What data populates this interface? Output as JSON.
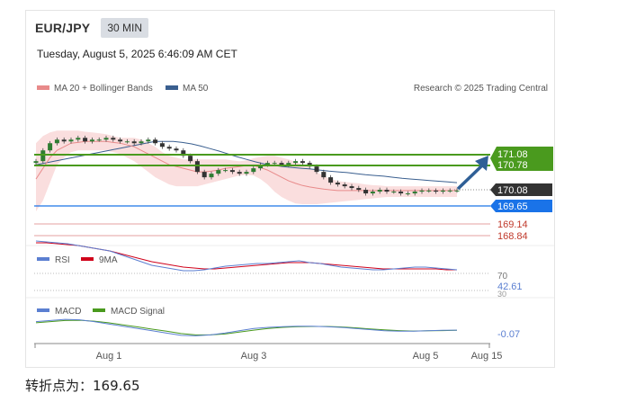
{
  "header": {
    "pair": "EUR/JPY",
    "interval": "30 MIN",
    "datetime": "Tuesday, August 5, 2025 6:46:09 AM CET"
  },
  "legend": {
    "ma20": "MA 20 + Bollinger Bands",
    "ma50": "MA 50",
    "credit": "Research © 2025 Trading Central",
    "ma20_color": "#e88a8a",
    "ma50_color": "#3a5f8f"
  },
  "levels": {
    "resistance1": "171.08",
    "resistance2": "170.78",
    "last": "170.08",
    "pivot": "169.65",
    "support1": "169.14",
    "support2": "168.84",
    "resistance_color": "#4a9a1e",
    "pivot_color": "#1a73e8",
    "support_color": "#c0392b",
    "last_color": "#333333"
  },
  "rsi": {
    "label": "RSI",
    "ma_label": "9MA",
    "upper": "70",
    "value": "42.61",
    "lower": "30",
    "rsi_color": "#5b7fd1",
    "ma_color": "#d0021b"
  },
  "macd": {
    "label": "MACD",
    "signal_label": "MACD Signal",
    "value": "-0.07",
    "macd_color": "#5b7fd1",
    "signal_color": "#4a9a1e"
  },
  "xaxis": {
    "ticks": [
      "Aug 1",
      "Aug 3",
      "Aug 5",
      "Aug 15"
    ]
  },
  "footer": {
    "text": "转折点为：169.65"
  },
  "chart_data": {
    "type": "line",
    "title": "EUR/JPY 30 MIN",
    "ylim": [
      168.6,
      171.6
    ],
    "price": {
      "x": [
        0,
        1,
        2,
        3,
        4,
        5,
        6,
        7,
        8,
        9,
        10,
        11,
        12,
        13,
        14,
        15,
        16,
        17,
        18,
        19,
        20,
        21,
        22,
        23,
        24,
        25,
        26,
        27,
        28,
        29,
        30,
        31,
        32,
        33,
        34,
        35,
        36,
        37,
        38,
        39,
        40,
        41,
        42,
        43,
        44,
        45,
        46,
        47,
        48,
        49,
        50,
        51,
        52,
        53,
        54,
        55,
        56,
        57,
        58,
        59,
        60
      ],
      "close": [
        170.9,
        171.2,
        171.4,
        171.5,
        171.45,
        171.5,
        171.55,
        171.45,
        171.5,
        171.5,
        171.55,
        171.5,
        171.45,
        171.45,
        171.4,
        171.45,
        171.5,
        171.4,
        171.3,
        171.25,
        171.2,
        171.05,
        170.9,
        170.6,
        170.45,
        170.55,
        170.65,
        170.65,
        170.6,
        170.55,
        170.6,
        170.7,
        170.8,
        170.85,
        170.85,
        170.8,
        170.85,
        170.9,
        170.85,
        170.75,
        170.6,
        170.45,
        170.3,
        170.25,
        170.2,
        170.15,
        170.1,
        170.0,
        170.05,
        170.1,
        170.05,
        170.05,
        170.0,
        170.0,
        170.05,
        170.08,
        170.08,
        170.05,
        170.08,
        170.08,
        170.08
      ],
      "ma20": [
        170.4,
        170.7,
        171.0,
        171.2,
        171.3,
        171.4,
        171.42,
        171.45,
        171.45,
        171.45,
        171.45,
        171.42,
        171.4,
        171.35,
        171.3,
        171.2,
        171.1,
        171.0,
        170.9,
        170.8,
        170.75,
        170.7,
        170.65,
        170.6,
        170.6,
        170.62,
        170.65,
        170.7,
        170.72,
        170.75,
        170.78,
        170.78,
        170.72,
        170.65,
        170.55,
        170.45,
        170.35,
        170.28,
        170.22,
        170.18,
        170.15,
        170.12,
        170.1,
        170.08,
        170.08,
        170.08,
        170.08,
        170.08,
        170.08,
        170.08,
        170.08,
        170.08,
        170.08,
        170.08,
        170.08,
        170.08,
        170.08,
        170.08,
        170.08,
        170.08,
        170.08
      ],
      "bb_upper": [
        171.4,
        171.6,
        171.7,
        171.75,
        171.75,
        171.75,
        171.75,
        171.72,
        171.7,
        171.68,
        171.65,
        171.6,
        171.55,
        171.55,
        171.55,
        171.5,
        171.4,
        171.3,
        171.15,
        171.05,
        171.0,
        170.95,
        170.95,
        170.95,
        170.95,
        170.95,
        170.95,
        170.95,
        170.92,
        170.9,
        170.92,
        170.98,
        171.02,
        171.05,
        171.05,
        171.0,
        170.95,
        170.88,
        170.8,
        170.72,
        170.6,
        170.48,
        170.4,
        170.35,
        170.32,
        170.3,
        170.28,
        170.25,
        170.23,
        170.22,
        170.2,
        170.2,
        170.2,
        170.2,
        170.2,
        170.2,
        170.2,
        170.2,
        170.2,
        170.2,
        170.2
      ],
      "bb_lower": [
        169.5,
        169.8,
        170.3,
        170.8,
        171.0,
        171.15,
        171.2,
        171.2,
        171.2,
        171.2,
        171.2,
        171.15,
        171.1,
        171.0,
        170.9,
        170.75,
        170.6,
        170.45,
        170.35,
        170.25,
        170.2,
        170.2,
        170.2,
        170.2,
        170.25,
        170.3,
        170.35,
        170.4,
        170.45,
        170.5,
        170.52,
        170.5,
        170.4,
        170.25,
        170.05,
        169.9,
        169.8,
        169.72,
        169.7,
        169.7,
        169.7,
        169.72,
        169.74,
        169.76,
        169.78,
        169.8,
        169.82,
        169.84,
        169.86,
        169.88,
        169.9,
        169.9,
        169.9,
        169.9,
        169.9,
        169.9,
        169.9,
        169.9,
        169.9,
        169.9,
        169.9
      ],
      "ma50": [
        170.8,
        170.85,
        170.9,
        170.95,
        171.0,
        171.05,
        171.1,
        171.15,
        171.2,
        171.25,
        171.3,
        171.35,
        171.4,
        171.45,
        171.45,
        171.45,
        171.42,
        171.38,
        171.32,
        171.25,
        171.18,
        171.1,
        171.02,
        170.95,
        170.88,
        170.82,
        170.78,
        170.75,
        170.72,
        170.7,
        170.68,
        170.65,
        170.62,
        170.6,
        170.58,
        170.55,
        170.52,
        170.5,
        170.48,
        170.45,
        170.42,
        170.4,
        170.38,
        170.36,
        170.34,
        170.32,
        170.3
      ]
    },
    "levels": {
      "resistance": [
        171.08,
        170.78
      ],
      "last": 170.08,
      "pivot": 169.65,
      "support": [
        169.14,
        168.84
      ]
    },
    "rsi": {
      "ylim": [
        20,
        80
      ],
      "rsi": [
        75,
        74,
        73,
        72,
        70,
        68,
        66,
        64,
        60,
        56,
        52,
        48,
        46,
        44,
        42,
        42,
        43,
        45,
        47,
        48,
        49,
        50,
        50,
        51,
        52,
        53,
        51,
        50,
        48,
        46,
        45,
        44,
        43,
        43,
        44,
        45,
        46,
        46,
        45,
        44,
        43
      ],
      "ma9": [
        73,
        73,
        72,
        71,
        70,
        68,
        66,
        64,
        61,
        58,
        55,
        52,
        50,
        48,
        46,
        45,
        44,
        44,
        45,
        46,
        47,
        48,
        49,
        50,
        51,
        51,
        51,
        50,
        49,
        48,
        47,
        46,
        45,
        44,
        44,
        44,
        44,
        44,
        44,
        43,
        43
      ]
    },
    "macd": {
      "ylim": [
        -0.5,
        0.6
      ],
      "macd": [
        0.3,
        0.35,
        0.4,
        0.38,
        0.3,
        0.2,
        0.1,
        0.0,
        -0.1,
        -0.2,
        -0.3,
        -0.32,
        -0.28,
        -0.2,
        -0.1,
        0.0,
        0.05,
        0.08,
        0.1,
        0.1,
        0.08,
        0.05,
        0.0,
        -0.05,
        -0.1,
        -0.12,
        -0.12,
        -0.1,
        -0.08,
        -0.07
      ],
      "signal": [
        0.25,
        0.3,
        0.35,
        0.36,
        0.32,
        0.25,
        0.16,
        0.07,
        -0.03,
        -0.12,
        -0.22,
        -0.28,
        -0.28,
        -0.24,
        -0.16,
        -0.07,
        0.0,
        0.05,
        0.08,
        0.09,
        0.09,
        0.07,
        0.03,
        -0.02,
        -0.06,
        -0.09,
        -0.11,
        -0.1,
        -0.09,
        -0.08
      ]
    }
  }
}
